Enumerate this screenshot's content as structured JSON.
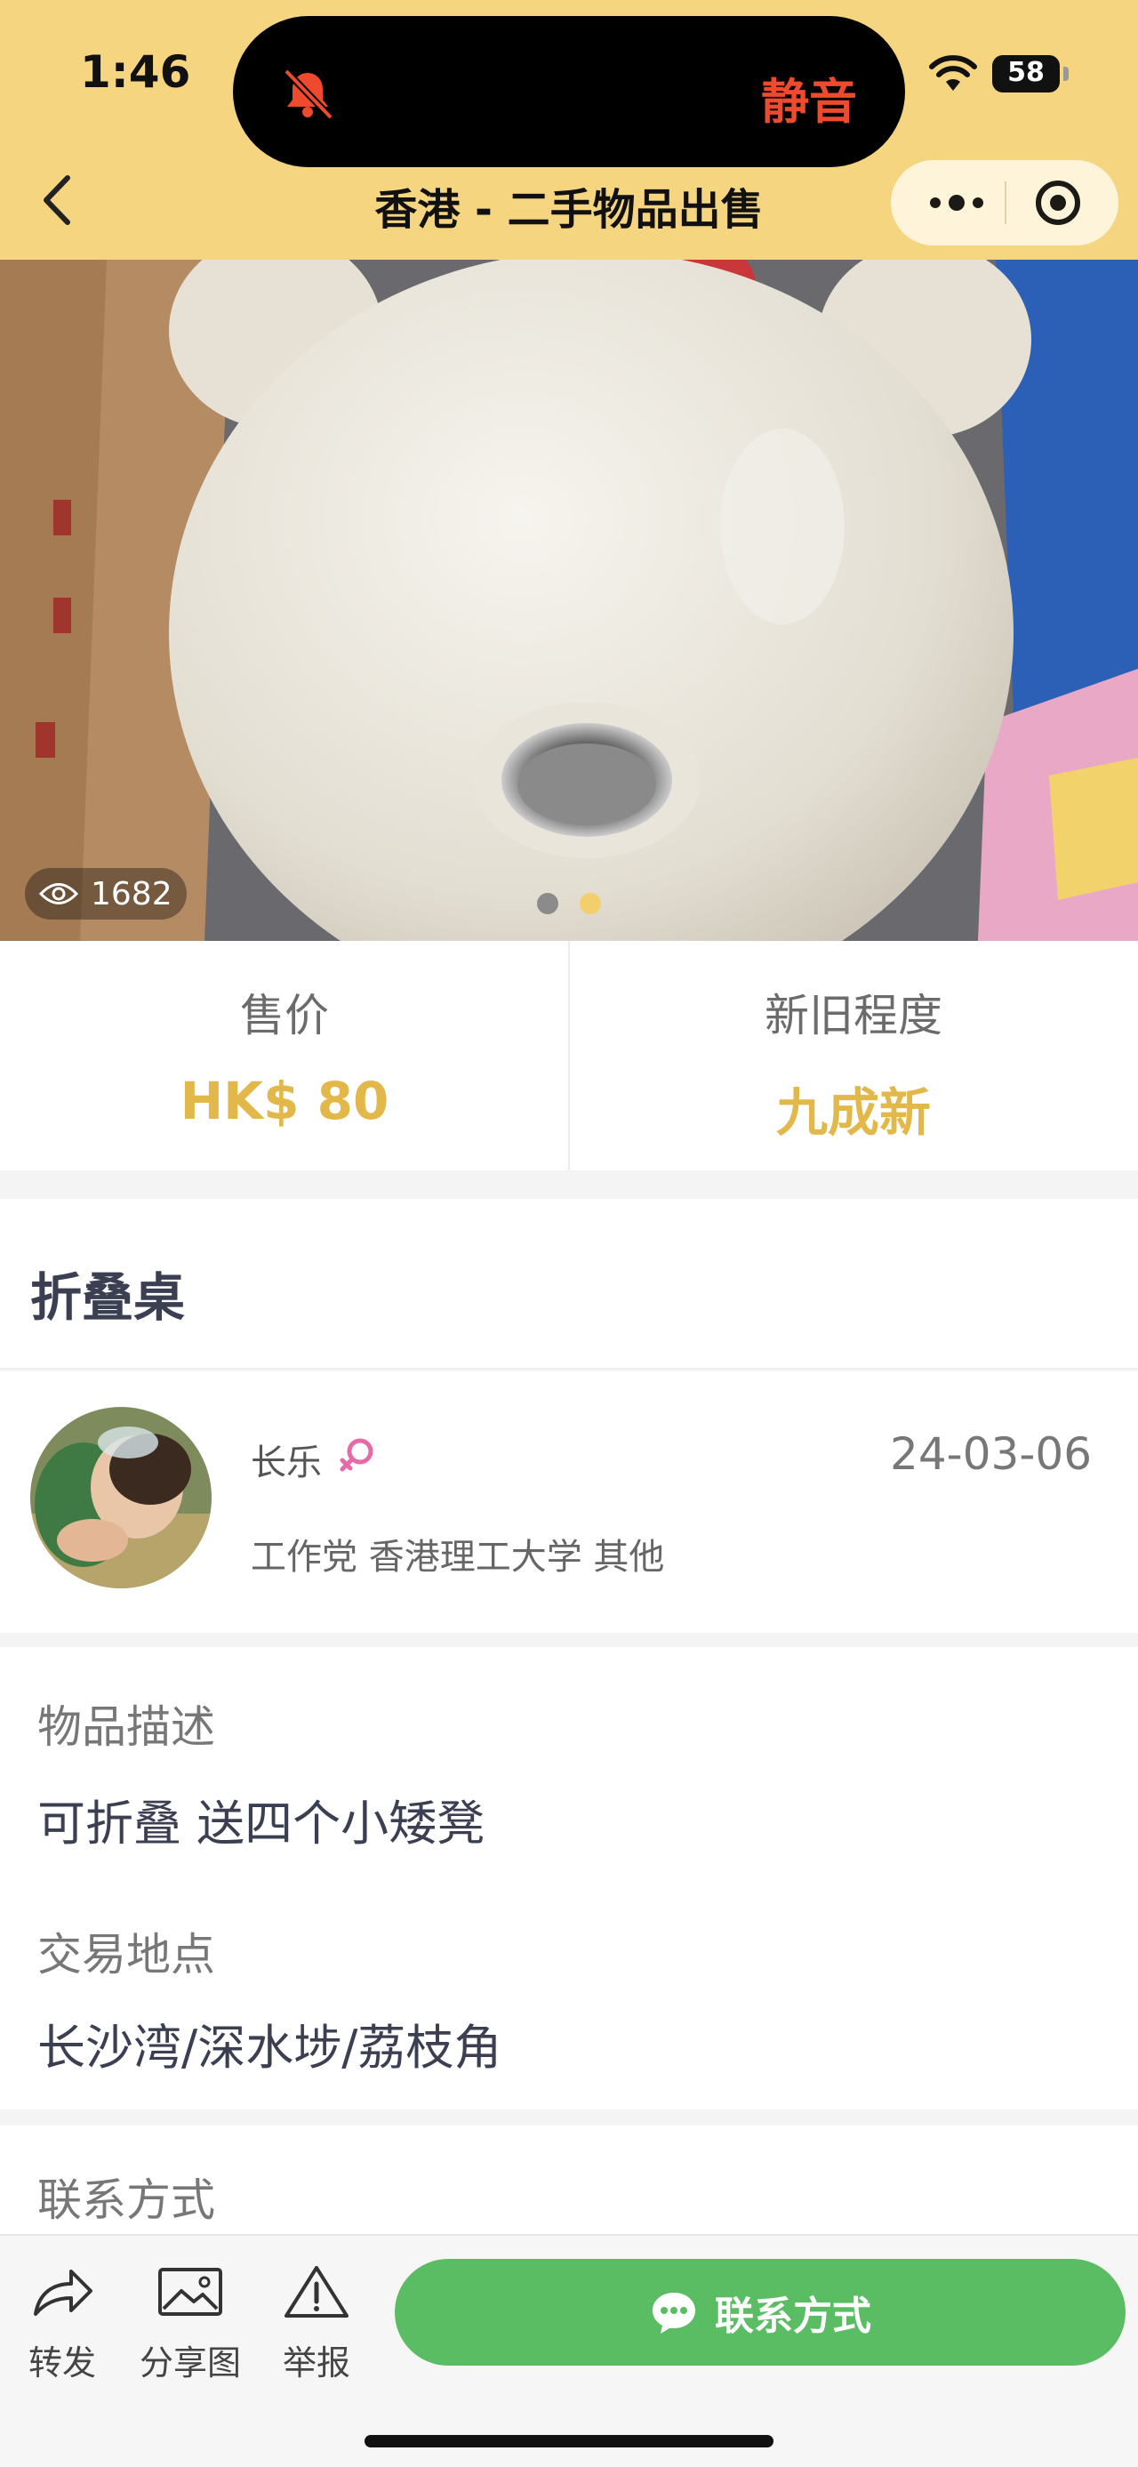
{
  "status_bar": {
    "time": "1:46",
    "mute_label": "静音",
    "battery": "58"
  },
  "nav": {
    "title": "香港 - 二手物品出售"
  },
  "gallery": {
    "views": "1682",
    "active_index": 2,
    "total": 2
  },
  "price": {
    "label": "售价",
    "value": "HK$ 80"
  },
  "condition": {
    "label": "新旧程度",
    "value": "九成新"
  },
  "item": {
    "title": "折叠桌"
  },
  "seller": {
    "name": "长乐",
    "date": "24-03-06",
    "tags": "工作党 香港理工大学 其他"
  },
  "description": {
    "label": "物品描述",
    "value": "可折叠 送四个小矮凳"
  },
  "location": {
    "label": "交易地点",
    "value": "长沙湾/深水埗/荔枝角"
  },
  "contact": {
    "label": "联系方式"
  },
  "bottom_bar": {
    "share_label": "转发",
    "share_image_label": "分享图",
    "report_label": "举报",
    "contact_button_label": "联系方式"
  },
  "colors": {
    "header": "#f5d57f",
    "accent": "#e2b84b",
    "button": "#5bbd63",
    "mute": "#ef4a2d"
  },
  "icons": [
    "bell-slash-icon",
    "wifi-icon",
    "battery-icon",
    "back-chevron-icon",
    "more-dots-icon",
    "target-icon",
    "eye-icon",
    "female-icon",
    "share-arrow-icon",
    "image-icon",
    "warning-icon",
    "chat-bubble-icon"
  ]
}
